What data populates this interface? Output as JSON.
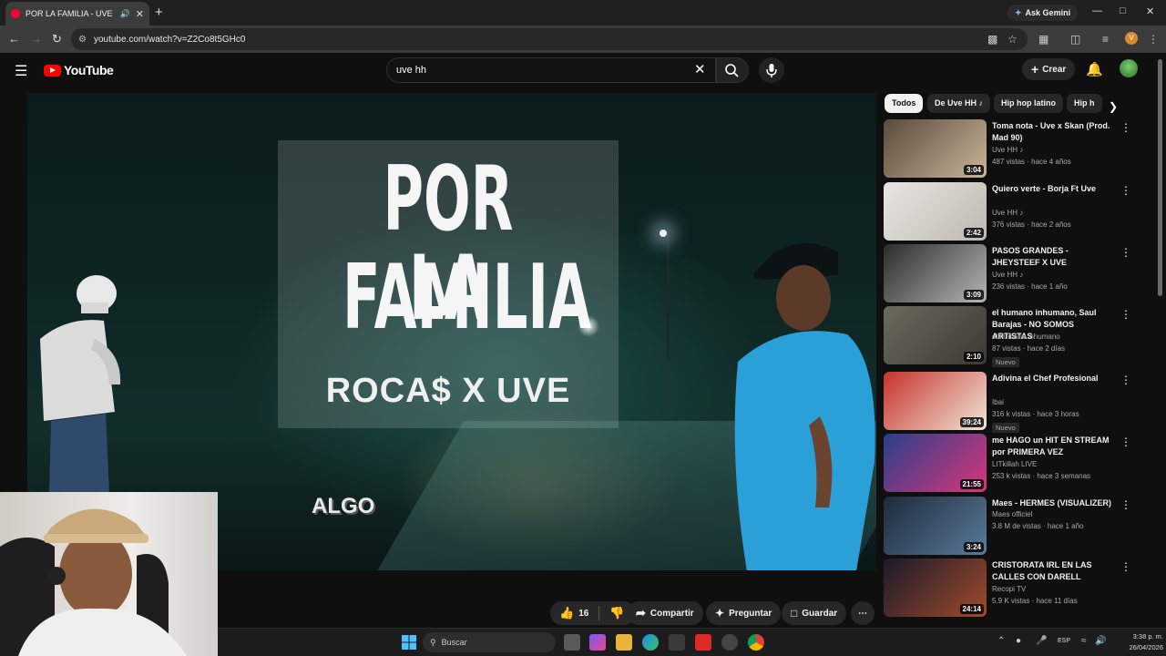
{
  "browser": {
    "tab_title": "POR LA FAMILIA - UVE X R",
    "new_tab_label": "+",
    "ask_gemini": "Ask Gemini",
    "url": "youtube.com/watch?v=Z2Co8t5GHc0",
    "profile_initial": "V"
  },
  "youtube": {
    "logo_text": "YouTube",
    "search_value": "uve hh",
    "create_label": "Crear"
  },
  "video_frame": {
    "line1": "POR LA",
    "line2": "FAMILIA",
    "line3": "ROCA$ X UVE",
    "overlay": "ALGO"
  },
  "actions": {
    "like_count": "16",
    "share_label": "Compartir",
    "ask_label": "Preguntar",
    "save_label": "Guardar"
  },
  "chips": [
    "Todos",
    "De Uve HH ♪",
    "Hip hop latino",
    "Hip h"
  ],
  "recommendations": [
    {
      "title": "Toma nota - Uve x Skan  (Prod. Mad 90)",
      "channel": "Uve HH ♪",
      "meta": "487 vistas · hace 4 años",
      "duration": "3:04",
      "badge": "",
      "colors": [
        "#5a4a3a",
        "#c9b59a"
      ]
    },
    {
      "title": "Quiero verte - Borja Ft Uve",
      "channel": "Uve HH ♪",
      "meta": "376 vistas · hace 2 años",
      "duration": "2:42",
      "badge": "",
      "colors": [
        "#e8e6e2",
        "#bdb8b0"
      ]
    },
    {
      "title": "PASOS GRANDES - JHEYSTEEF X UVE",
      "channel": "Uve HH ♪",
      "meta": "236 vistas · hace 1 año",
      "duration": "3:09",
      "badge": "",
      "colors": [
        "#2c2c2c",
        "#b5b5b5"
      ]
    },
    {
      "title": "el humano inhumano, Saul Barajas - NO SOMOS ARTISTAS",
      "channel": "el humano inhumano",
      "meta": "87 vistas · hace 2 días",
      "duration": "2:10",
      "badge": "Nuevo",
      "colors": [
        "#6a6a5e",
        "#3a3a34"
      ]
    },
    {
      "title": "Adivina el Chef Profesional",
      "channel": "Ibai",
      "meta": "316 k vistas · hace 3 horas",
      "duration": "39:24",
      "badge": "Nuevo",
      "colors": [
        "#c7332b",
        "#f0e6d8"
      ]
    },
    {
      "title": "me HAGO un HIT EN STREAM por PRIMERA VEZ",
      "channel": "LITkillah LIVE",
      "meta": "253 k vistas · hace 3 semanas",
      "duration": "21:55",
      "badge": "",
      "colors": [
        "#2a3f8a",
        "#d8367a"
      ]
    },
    {
      "title": "Maes - HERMES (VISUALIZER)",
      "channel": "Maes officiel",
      "meta": "3.8 M de vistas · hace 1 año",
      "duration": "3:24",
      "badge": "",
      "colors": [
        "#1d2a3a",
        "#5a7a9a"
      ]
    },
    {
      "title": "CRISTORATA IRL EN LAS CALLES CON DARELL",
      "channel": "Recopi TV",
      "meta": "5.9 K vistas · hace 11 días",
      "duration": "24:14",
      "badge": "",
      "colors": [
        "#1a1a2a",
        "#a04a2a"
      ]
    }
  ],
  "taskbar": {
    "search_label": "Buscar",
    "lang": "ESP",
    "time": "3:38 p. m.",
    "date": "26/04/2026"
  }
}
